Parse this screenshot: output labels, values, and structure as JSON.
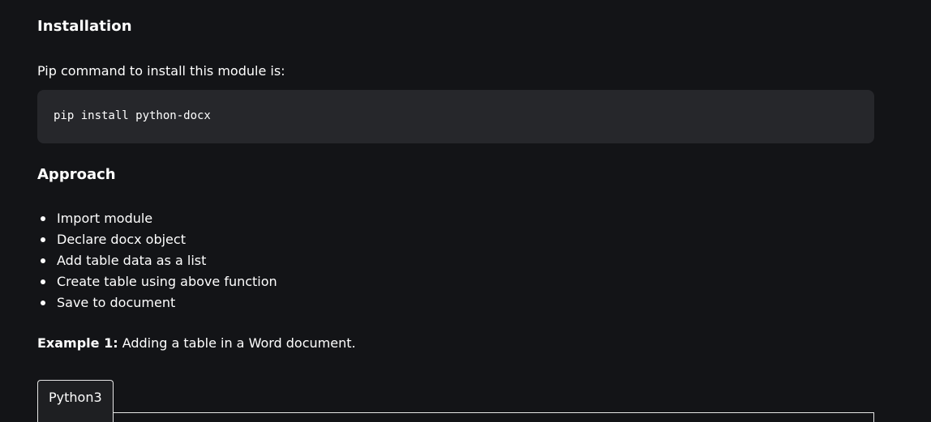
{
  "installation": {
    "heading": "Installation",
    "intro": "Pip command to install this module is:",
    "code": "pip install python-docx"
  },
  "approach": {
    "heading": "Approach",
    "steps": [
      "Import module",
      "Declare docx object",
      "Add table data as a list",
      "Create table using above function",
      "Save to document"
    ]
  },
  "example": {
    "label": "Example 1:",
    "text": " Adding a table in a Word document."
  },
  "code_tabs": {
    "active_tab": "Python3"
  },
  "colors": {
    "background": "#131417",
    "code_background": "#26272b",
    "text": "#ffffff"
  }
}
